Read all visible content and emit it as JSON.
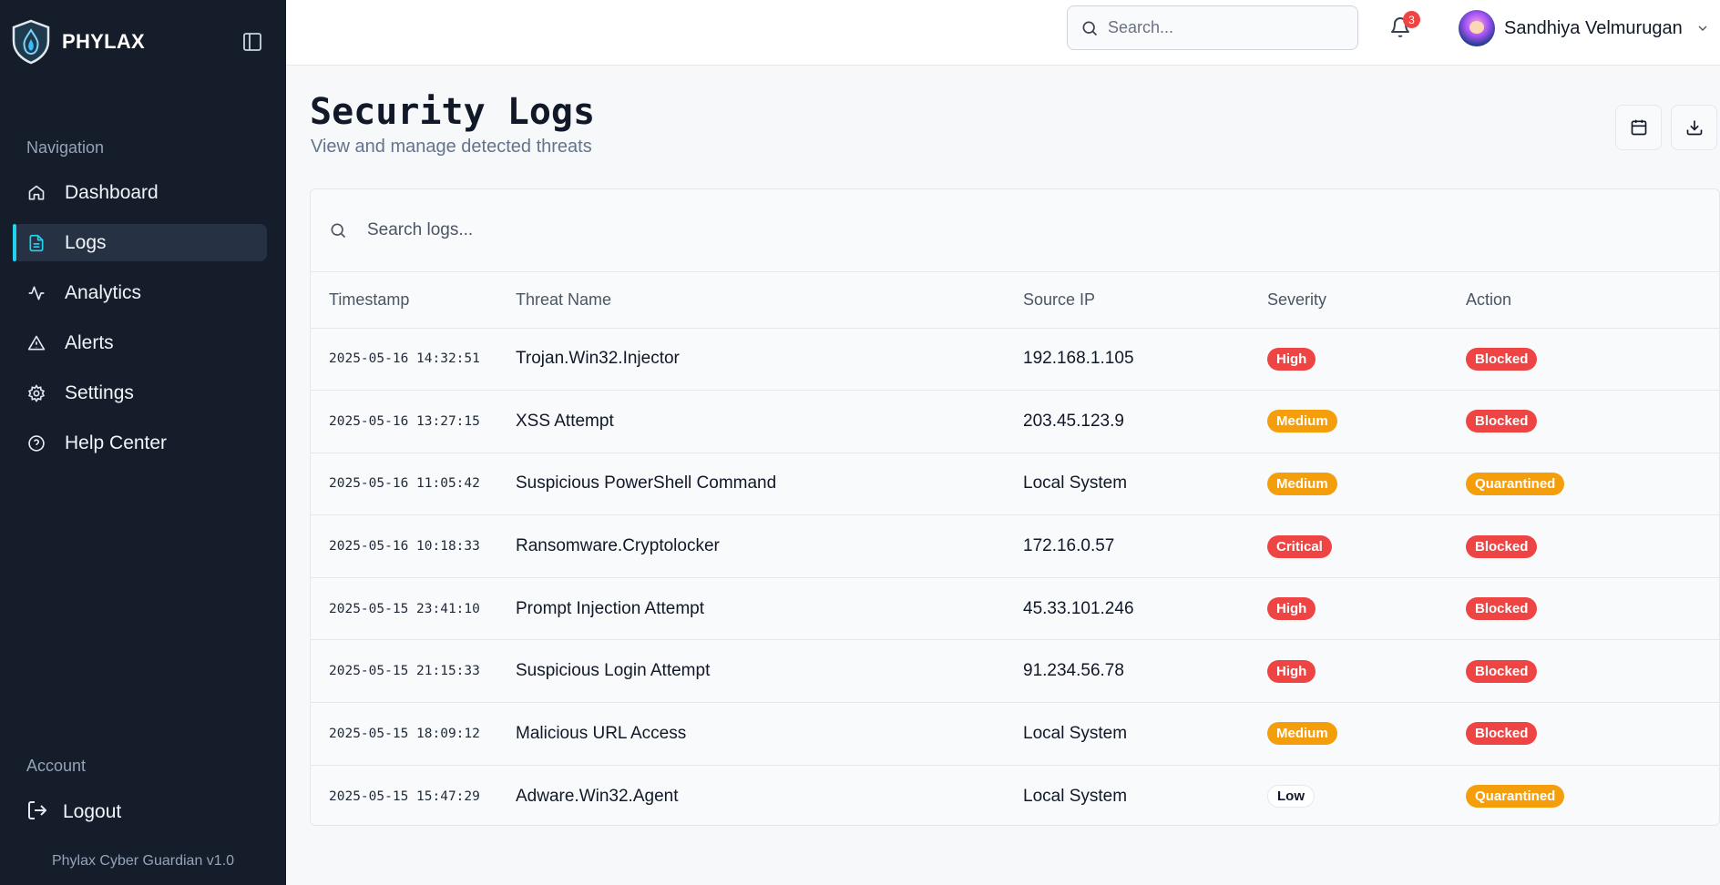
{
  "sidebar": {
    "brand": "PHYLAX",
    "nav_section": "Navigation",
    "items": [
      {
        "label": "Dashboard",
        "icon": "home-icon"
      },
      {
        "label": "Logs",
        "icon": "file-text-icon",
        "active": true
      },
      {
        "label": "Analytics",
        "icon": "activity-icon"
      },
      {
        "label": "Alerts",
        "icon": "alert-triangle-icon"
      },
      {
        "label": "Settings",
        "icon": "gear-icon"
      },
      {
        "label": "Help Center",
        "icon": "help-circle-icon"
      }
    ],
    "account_section": "Account",
    "logout": "Logout",
    "version": "Phylax Cyber Guardian v1.0"
  },
  "topbar": {
    "search_placeholder": "Search...",
    "notification_count": "3",
    "user_name": "Sandhiya Velmurugan"
  },
  "page": {
    "title": "Security Logs",
    "subtitle": "View and manage detected threats"
  },
  "logs": {
    "search_placeholder": "Search logs...",
    "columns": [
      "Timestamp",
      "Threat Name",
      "Source IP",
      "Severity",
      "Action"
    ],
    "rows": [
      {
        "timestamp": "2025-05-16 14:32:51",
        "threat": "Trojan.Win32.Injector",
        "source": "192.168.1.105",
        "severity": "High",
        "action": "Blocked"
      },
      {
        "timestamp": "2025-05-16 13:27:15",
        "threat": "XSS Attempt",
        "source": "203.45.123.9",
        "severity": "Medium",
        "action": "Blocked"
      },
      {
        "timestamp": "2025-05-16 11:05:42",
        "threat": "Suspicious PowerShell Command",
        "source": "Local System",
        "severity": "Medium",
        "action": "Quarantined"
      },
      {
        "timestamp": "2025-05-16 10:18:33",
        "threat": "Ransomware.Cryptolocker",
        "source": "172.16.0.57",
        "severity": "Critical",
        "action": "Blocked"
      },
      {
        "timestamp": "2025-05-15 23:41:10",
        "threat": "Prompt Injection Attempt",
        "source": "45.33.101.246",
        "severity": "High",
        "action": "Blocked"
      },
      {
        "timestamp": "2025-05-15 21:15:33",
        "threat": "Suspicious Login Attempt",
        "source": "91.234.56.78",
        "severity": "High",
        "action": "Blocked"
      },
      {
        "timestamp": "2025-05-15 18:09:12",
        "threat": "Malicious URL Access",
        "source": "Local System",
        "severity": "Medium",
        "action": "Blocked"
      },
      {
        "timestamp": "2025-05-15 15:47:29",
        "threat": "Adware.Win32.Agent",
        "source": "Local System",
        "severity": "Low",
        "action": "Quarantined"
      }
    ]
  },
  "colors": {
    "sidebar_bg": "#151d2b",
    "accent": "#22d3ee",
    "danger": "#ef4444",
    "warning": "#f59e0b"
  }
}
